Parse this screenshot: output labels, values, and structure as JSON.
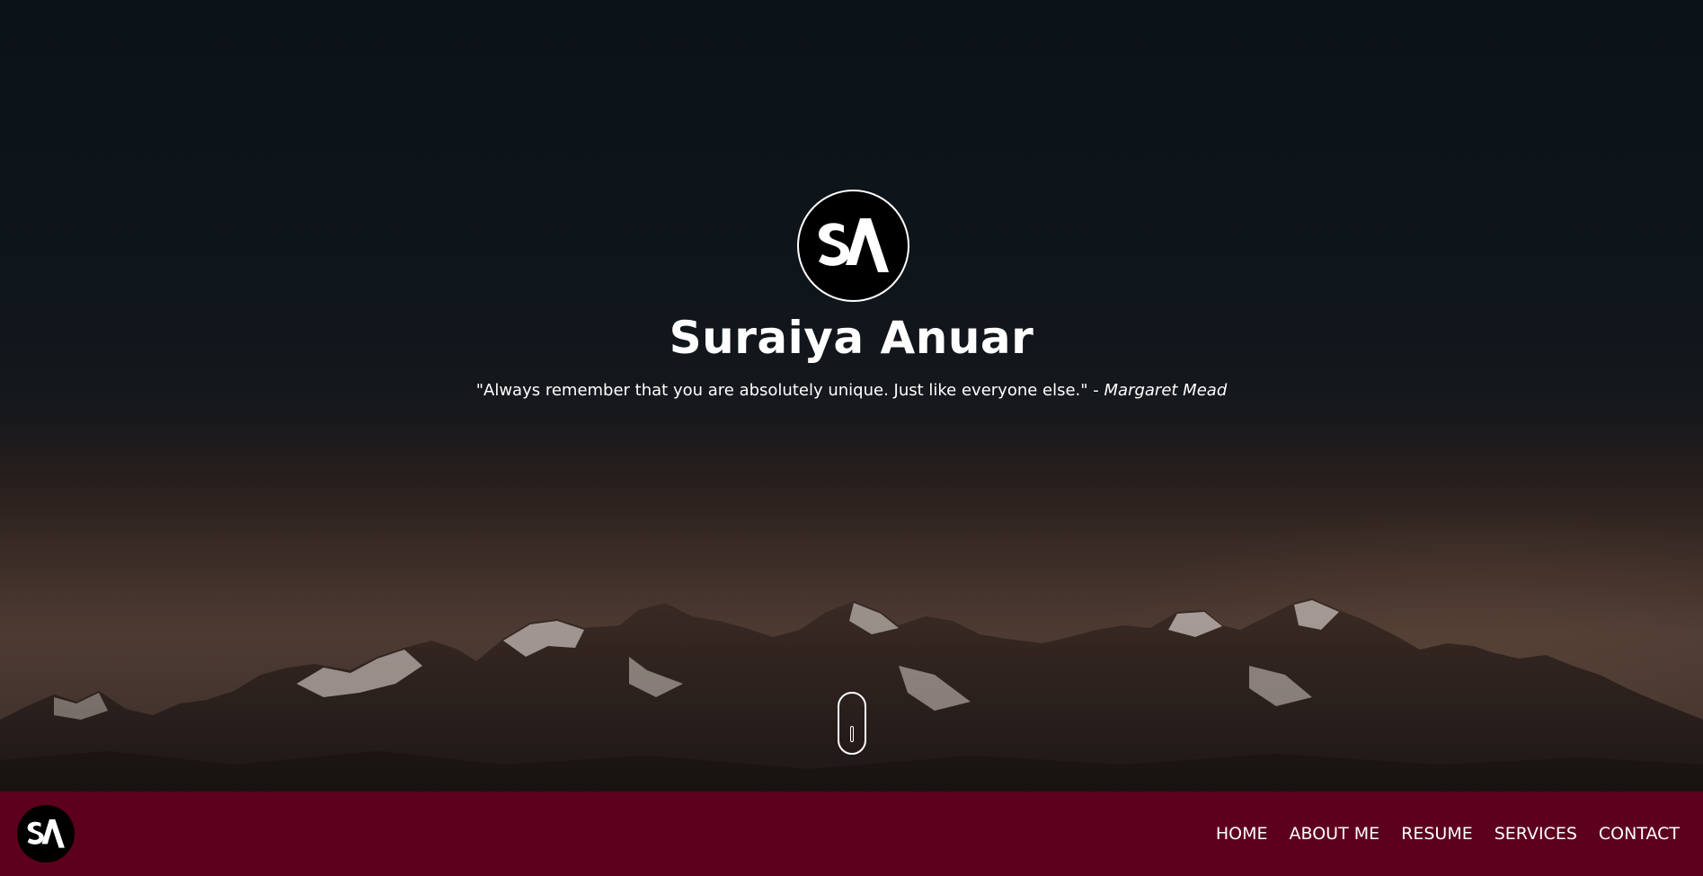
{
  "hero": {
    "name": "Suraiya Anuar",
    "quote": "\"Always remember that you are absolutely unique. Just like everyone else.\" -",
    "quote_author": "Margaret Mead",
    "logo_icon": "sa-monogram-logo",
    "scroll_icon": "mouse-scroll-icon"
  },
  "nav": {
    "logo_icon": "sa-monogram-logo",
    "items": [
      {
        "label": "HOME"
      },
      {
        "label": "ABOUT ME"
      },
      {
        "label": "RESUME"
      },
      {
        "label": "SERVICES"
      },
      {
        "label": "CONTACT"
      }
    ]
  },
  "colors": {
    "navbar_bg": "#5d001e",
    "hero_top": "#0b1218",
    "text": "#ffffff"
  }
}
